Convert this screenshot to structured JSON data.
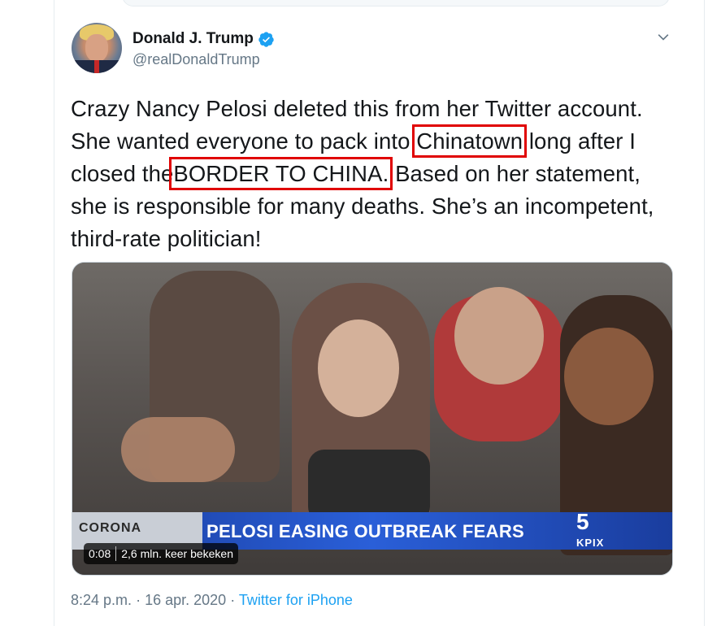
{
  "author": {
    "name": "Donald J. Trump",
    "handle": "@realDonaldTrump",
    "verified_color": "#1da1f2"
  },
  "tweet": {
    "text_parts": [
      "Crazy Nancy Pelosi deleted this from her Twitter account. She wanted everyone to pack into",
      "Chinatown",
      "long after I closed the",
      "BORDER TO CHINA.",
      "Based on her statement, she is responsible for many deaths. She’s an incompetent, third-rate politician!"
    ],
    "highlight_color": "#e00000"
  },
  "video": {
    "banner_left": "CORONA",
    "banner_text": "PELOSI EASING OUTBREAK FEARS",
    "station_logo": "5",
    "station_name": "KPIX",
    "duration": "0:08",
    "views": "2,6 mln. keer bekeken"
  },
  "meta": {
    "time": "8:24 p.m.",
    "separator1": "·",
    "date": "16 apr. 2020",
    "separator2": "·",
    "source": "Twitter for iPhone"
  },
  "icons": {
    "verified": "verified-badge-icon",
    "caret": "chevron-down-icon"
  },
  "colors": {
    "text": "#14171a",
    "secondary": "#657786",
    "link": "#1da1f2"
  }
}
